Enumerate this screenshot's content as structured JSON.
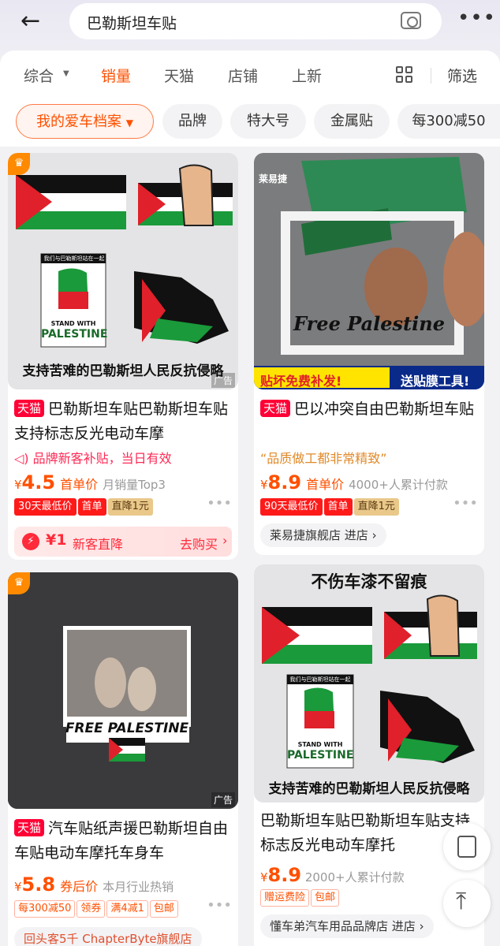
{
  "header": {
    "search_query": "巴勒斯坦车贴",
    "more_label": "•••"
  },
  "sort": {
    "items": [
      "综合",
      "销量",
      "天猫",
      "店铺",
      "上新"
    ],
    "filter_label": "筛选"
  },
  "chips": [
    "我的爱车档案",
    "品牌",
    "特大号",
    "金属贴",
    "每300减50"
  ],
  "products": [
    {
      "tmall": "天猫",
      "title": "巴勒斯坦车贴巴勒斯坦车贴支持标志反光电动车摩",
      "promo": "品牌新客补贴，当日有效",
      "price_yen": "¥",
      "price": "4.5",
      "price_label": "首单价",
      "sales": "月销量Top3",
      "tags": [
        "30天最低价",
        "首单",
        "直降1元"
      ],
      "coupon_amount": "¥1",
      "coupon_text": "新客直降",
      "coupon_action": "去购买",
      "image_caption": "支持苦难的巴勒斯坦人民反抗侵略",
      "image_sticker_top": "我们与巴勒斯坦站在一起",
      "image_stand": "STAND WITH",
      "image_palestine": "PALESTINE",
      "ad": "广告"
    },
    {
      "tmall": "天猫",
      "title": "巴以冲突自由巴勒斯坦车贴",
      "quote": "“品质做工都非常精致”",
      "price_yen": "¥",
      "price": "8.9",
      "price_label": "首单价",
      "sales": "4000+人累计付款",
      "tags": [
        "90天最低价",
        "首单",
        "直降1元"
      ],
      "shop": "莱易捷旗舰店 进店",
      "image_brand": "莱易捷",
      "image_caption": "Free Palestine",
      "image_banner_left": "贴坏免费补发!",
      "image_banner_right": "送贴膜工具!"
    },
    {
      "tmall": "天猫",
      "title": "汽车贴纸声援巴勒斯坦自由车贴电动车摩托车身车",
      "price_yen": "¥",
      "price": "5.8",
      "price_label": "券后价",
      "sales": "本月行业热销",
      "tags": [
        "每300减50",
        "领券",
        "满4减1",
        "包邮"
      ],
      "shop": "回头客5千 ChapterByte旗舰店",
      "image_caption": "FREE PALESTINE",
      "ad": "广告"
    },
    {
      "title": "巴勒斯坦车贴巴勒斯坦车贴支持标志反光电动车摩托",
      "price_yen": "¥",
      "price": "8.9",
      "sales": "2000+人累计付款",
      "tags": [
        "赠运费险",
        "包邮"
      ],
      "shop": "懂车弟汽车用品品牌店 进店",
      "image_top": "不伤车漆不留痕",
      "image_caption": "支持苦难的巴勒斯坦人民反抗侵略",
      "image_sticker_top": "我们与巴勒斯坦站在一起",
      "image_stand": "STAND WITH",
      "image_palestine": "PALESTINE"
    }
  ]
}
